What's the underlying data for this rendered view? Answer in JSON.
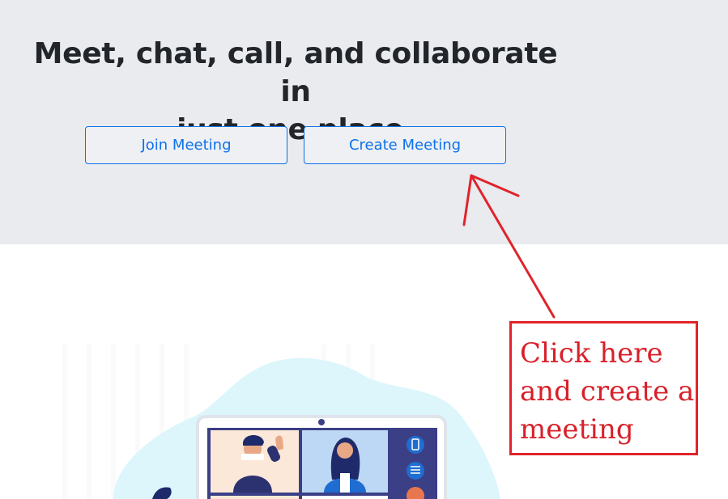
{
  "hero": {
    "headline_line1": "Meet, chat, call, and collaborate in",
    "headline_line2": "just one place."
  },
  "buttons": {
    "join_label": "Join Meeting",
    "create_label": "Create Meeting"
  },
  "annotation": {
    "line1": "Click here",
    "line2": "and create a",
    "line3": "meeting"
  },
  "colors": {
    "hero_background": "#e9ebee",
    "accent": "#0e71eb",
    "annotation_red": "#e0242c",
    "headline_text": "#222529"
  },
  "icons": {
    "arrow": "red-arrow-icon",
    "illustration": "video-conference-illustration"
  }
}
